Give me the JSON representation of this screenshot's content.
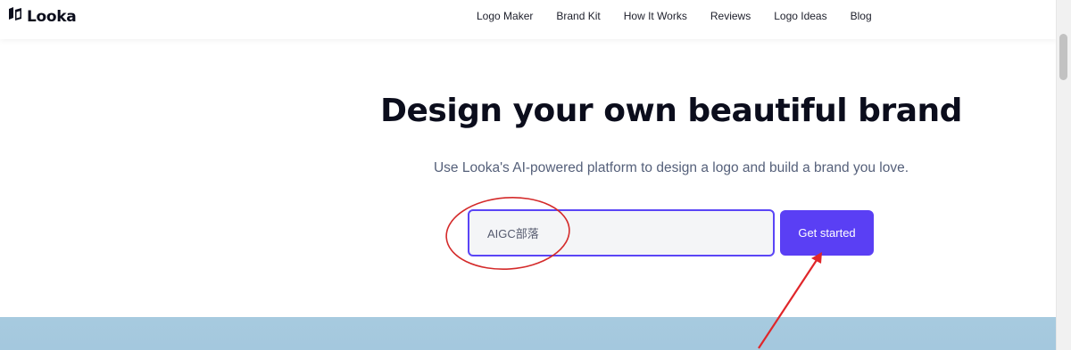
{
  "header": {
    "brand_name": "Looka",
    "brand_icon": "looka-logo-icon",
    "nav_items": [
      {
        "label": "Logo Maker"
      },
      {
        "label": "Brand Kit"
      },
      {
        "label": "How It Works"
      },
      {
        "label": "Reviews"
      },
      {
        "label": "Logo Ideas"
      },
      {
        "label": "Blog"
      }
    ]
  },
  "hero": {
    "title": "Design your own beautiful brand",
    "subtitle": "Use Looka's AI-powered platform to design a logo and build a brand you love.",
    "input_value": "AIGC部落",
    "cta_label": "Get started"
  },
  "annotations": {
    "circle_color": "#d42a2a",
    "arrow_color": "#e0262a"
  },
  "colors": {
    "accent": "#5a3ff4",
    "title": "#0b0d1c",
    "subtitle": "#55607a",
    "band": "#a7cadf"
  }
}
